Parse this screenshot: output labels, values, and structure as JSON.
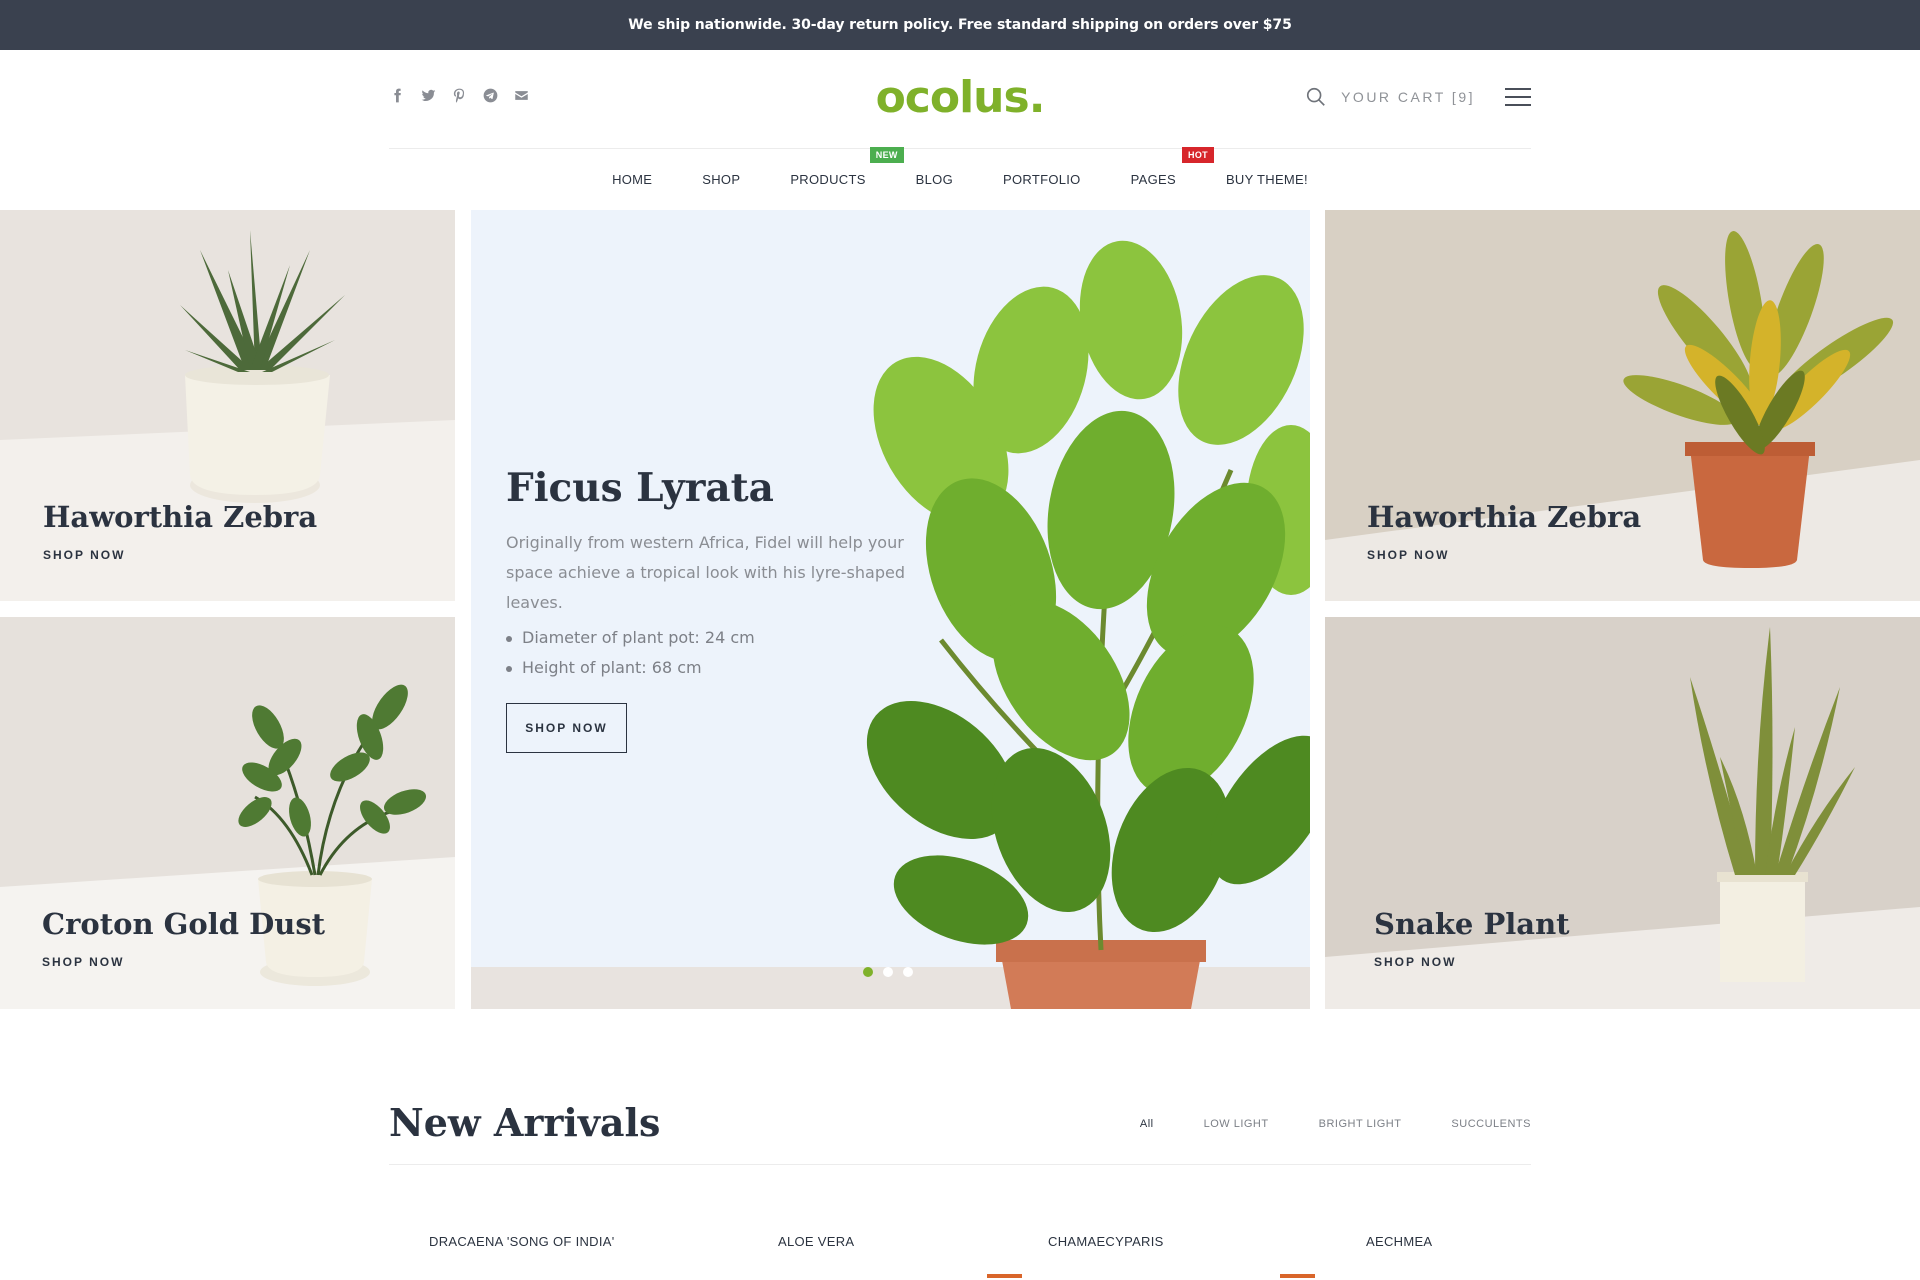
{
  "announcement": "We ship nationwide. 30-day return policy. Free standard shipping on orders over $75",
  "header": {
    "logo": "ocolus.",
    "social_icons": [
      "facebook-icon",
      "twitter-icon",
      "pinterest-icon",
      "telegram-icon",
      "email-icon"
    ],
    "cart_label": "YOUR CART [9]"
  },
  "nav": {
    "items": [
      {
        "label": "HOME"
      },
      {
        "label": "SHOP"
      },
      {
        "label": "PRODUCTS",
        "badge": "NEW"
      },
      {
        "label": "BLOG"
      },
      {
        "label": "PORTFOLIO"
      },
      {
        "label": "PAGES",
        "badge": "HOT"
      },
      {
        "label": "BUY THEME!"
      }
    ]
  },
  "hero": {
    "tiles": [
      {
        "title": "Haworthia Zebra",
        "link": "SHOP NOW"
      },
      {
        "title": "Croton Gold Dust",
        "link": "SHOP NOW"
      },
      {
        "title": "Haworthia Zebra",
        "link": "SHOP NOW"
      },
      {
        "title": "Snake Plant",
        "link": "SHOP NOW"
      }
    ],
    "slide": {
      "title": "Ficus Lyrata",
      "description": "Originally from western Africa, Fidel will help your space achieve a tropical look with his lyre-shaped leaves.",
      "features": [
        "Diameter of plant pot: 24 cm",
        "Height of plant: 68 cm"
      ],
      "cta": "SHOP NOW",
      "slide_count": 3,
      "active_slide": 1
    }
  },
  "arrivals": {
    "title": "New Arrivals",
    "filters": [
      "All",
      "LOW LIGHT",
      "BRIGHT LIGHT",
      "SUCCULENTS"
    ],
    "products": [
      "DRACAENA 'SONG OF INDIA'",
      "ALOE VERA",
      "CHAMAECYPARIS",
      "AECHMEA"
    ]
  },
  "colors": {
    "accent": "#7fb12a",
    "topbar": "#3a414f",
    "text": "#2b3340",
    "badge_new": "#4cae4f",
    "badge_hot": "#d7262b",
    "sale": "#d9652a"
  }
}
